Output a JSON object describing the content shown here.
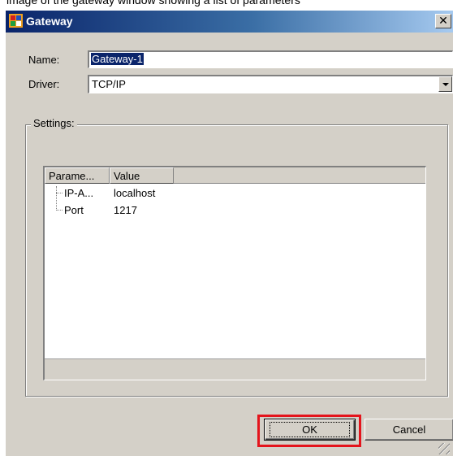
{
  "caption_fragment": "image of the gateway window showing a list of parameters",
  "window": {
    "title": "Gateway",
    "close_label": "✕"
  },
  "form": {
    "name_label": "Name:",
    "name_value": "Gateway-1",
    "driver_label": "Driver:",
    "driver_value": "TCP/IP"
  },
  "settings": {
    "legend": "Settings:",
    "columns": [
      "Parame...",
      "Value"
    ],
    "rows": [
      {
        "param": "IP-A...",
        "value": "localhost"
      },
      {
        "param": "Port",
        "value": "1217"
      }
    ]
  },
  "buttons": {
    "ok": "OK",
    "cancel": "Cancel"
  },
  "colors": {
    "title_start": "#0a246a",
    "title_end": "#a6caf0",
    "highlight": "#e4141c",
    "face": "#d4d0c8"
  }
}
